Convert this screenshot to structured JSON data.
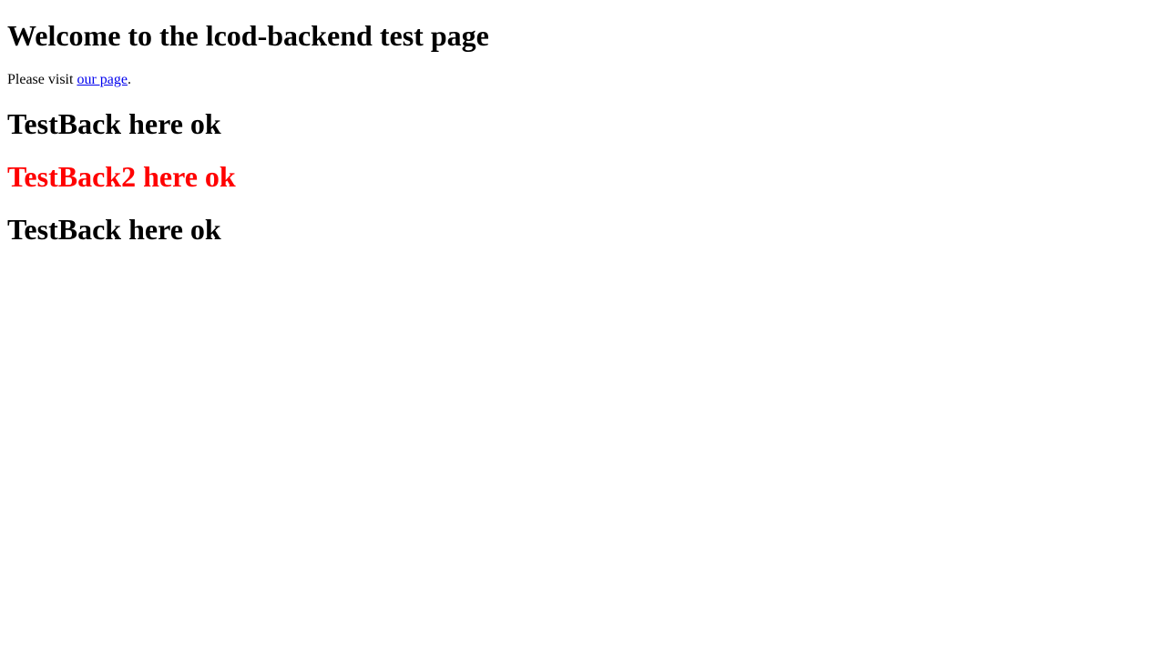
{
  "page": {
    "heading": "Welcome to the lcod-backend test page",
    "visit_prefix": "Please visit ",
    "visit_link": "our page",
    "visit_suffix": ".",
    "testback_1": "TestBack here ok",
    "testback_2": "TestBack2 here ok",
    "testback_3": "TestBack here ok"
  },
  "colors": {
    "link": "#0000ee",
    "testback_2": "#ff0000",
    "text": "#000000"
  }
}
